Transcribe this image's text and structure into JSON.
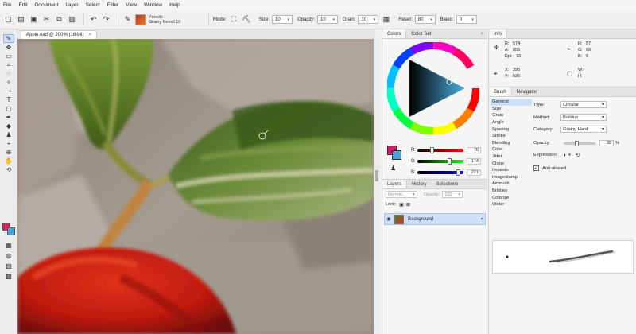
{
  "menu": [
    "File",
    "Edit",
    "Document",
    "Layer",
    "Select",
    "Filter",
    "View",
    "Window",
    "Help"
  ],
  "toolbar": {
    "brush_name_1": "Pencils",
    "brush_name_2": "Grainy Pencil 10",
    "mode_label": "Mode:",
    "size_label": "Size:",
    "size_value": "10",
    "opacity_label": "Opacity:",
    "opacity_value": "10",
    "grain_label": "Grain:",
    "grain_value": "10",
    "reset_label": "Reset:",
    "reset_value": "80",
    "bleed_label": "Bleed:",
    "bleed_value": "0"
  },
  "document": {
    "tab_title": "Apple.oad @ 200% (16-bit)",
    "close": "×"
  },
  "colors": {
    "tabs": [
      "Colors",
      "Color Set"
    ],
    "close": "×",
    "sliders": [
      {
        "label": "R",
        "value": "76"
      },
      {
        "label": "G",
        "value": "174"
      },
      {
        "label": "B",
        "value": "221"
      }
    ],
    "primary": "#d81b60",
    "secondary": "#4aa3dc"
  },
  "layers": {
    "tabs": [
      "Layers",
      "History",
      "Selections"
    ],
    "blend_mode": "Normal",
    "opacity_label": "Opacity:",
    "opacity_value": "100",
    "lock_label": "Lock:",
    "layer_name": "Background"
  },
  "info": {
    "title": "Info",
    "r_label": "R:",
    "r_value": "574",
    "a_label": "A:",
    "a_value": "855",
    "dpi_label": "Dpi:",
    "dpi_value": "73",
    "rgb_r_label": "R:",
    "rgb_r_value": "57",
    "rgb_g_label": "G:",
    "rgb_g_value": "68",
    "rgb_b_label": "B:",
    "rgb_b_value": "5",
    "x_label": "X:",
    "x_value": "395",
    "y_label": "Y:",
    "y_value": "536",
    "w_label": "W:",
    "h_label": "H:"
  },
  "brush": {
    "tabs": [
      "Brush",
      "Navigator"
    ],
    "categories": [
      "General",
      "Size",
      "Grain",
      "Angle",
      "Spacing",
      "Stroke",
      "Blending",
      "Color",
      "Jitter",
      "Clone",
      "Impasto",
      "Imagestamp",
      "Airbrush",
      "Bristles",
      "Colorize",
      "Water"
    ],
    "type_label": "Type:",
    "type_value": "Circular",
    "method_label": "Method:",
    "method_value": "Buildup",
    "category_label": "Category:",
    "category_value": "Grainy Hard",
    "opacity_label": "Opacity:",
    "opacity_value": "38",
    "opacity_unit": "%",
    "expression_label": "Expression:",
    "antialiased_label": "Anti-aliased"
  }
}
